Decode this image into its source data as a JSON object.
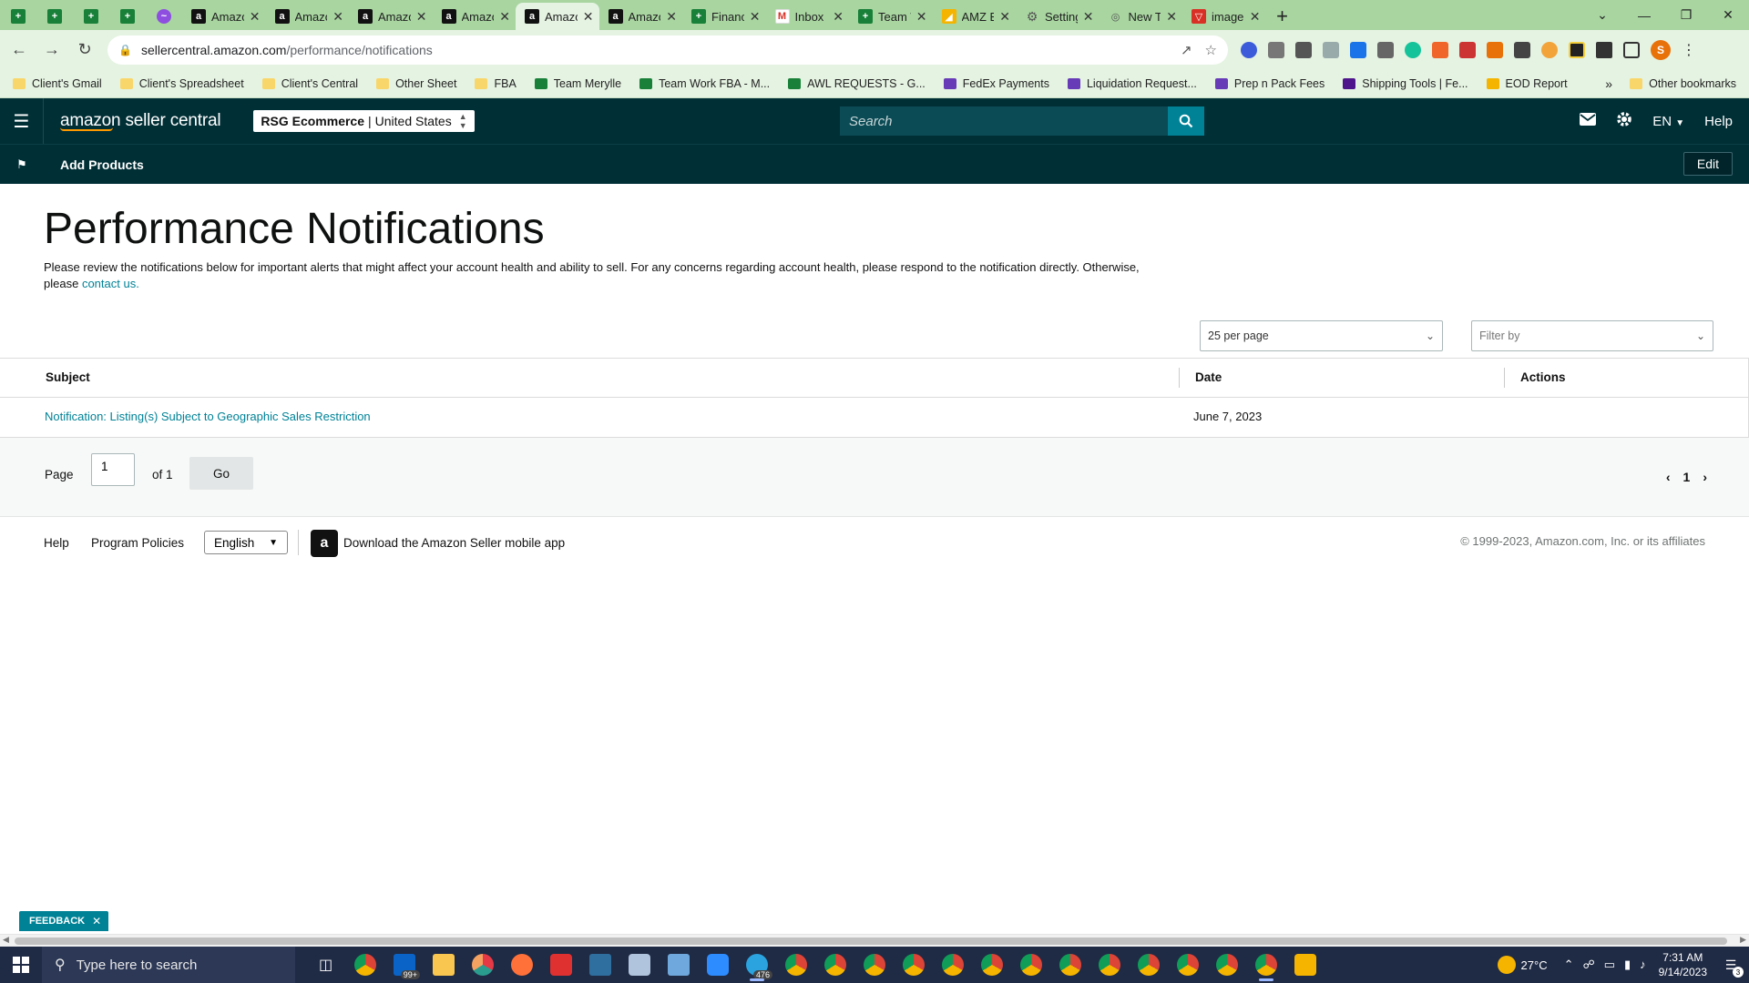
{
  "browser": {
    "tabs": [
      {
        "title": "",
        "icon": "sheets-icon",
        "pinned": true
      },
      {
        "title": "",
        "icon": "sheets-icon",
        "pinned": true
      },
      {
        "title": "",
        "icon": "sheets-icon",
        "pinned": true
      },
      {
        "title": "",
        "icon": "sheets-icon",
        "pinned": true
      },
      {
        "title": "",
        "icon": "messenger-icon",
        "pinned": true
      },
      {
        "title": "Amazon",
        "icon": "amazon-icon"
      },
      {
        "title": "Amazon",
        "icon": "amazon-icon"
      },
      {
        "title": "Amazon",
        "icon": "amazon-icon"
      },
      {
        "title": "Amazon",
        "icon": "amazon-icon"
      },
      {
        "title": "Amazon",
        "icon": "amazon-icon",
        "active": true
      },
      {
        "title": "Amazon",
        "icon": "amazon-icon"
      },
      {
        "title": "Finance",
        "icon": "sheets-icon"
      },
      {
        "title": "Inbox - r",
        "icon": "gmail-icon"
      },
      {
        "title": "Team Wo",
        "icon": "sheets-icon"
      },
      {
        "title": "AMZ EO",
        "icon": "amz-eod-icon"
      },
      {
        "title": "Settings",
        "icon": "gear-icon"
      },
      {
        "title": "New Tab",
        "icon": "globe-icon"
      },
      {
        "title": "image -",
        "icon": "image-icon"
      }
    ],
    "url_domain": "sellercentral.amazon.com",
    "url_path": "/performance/notifications",
    "bookmarks": [
      {
        "label": "Client's Gmail",
        "icon": "folder"
      },
      {
        "label": "Client's Spreadsheet",
        "icon": "folder"
      },
      {
        "label": "Client's Central",
        "icon": "folder"
      },
      {
        "label": "Other Sheet",
        "icon": "folder"
      },
      {
        "label": "FBA",
        "icon": "folder"
      },
      {
        "label": "Team Merylle",
        "icon": "sheet"
      },
      {
        "label": "Team Work FBA - M...",
        "icon": "sheet"
      },
      {
        "label": "AWL REQUESTS - G...",
        "icon": "sheet"
      },
      {
        "label": "FedEx Payments",
        "icon": "form"
      },
      {
        "label": "Liquidation Request...",
        "icon": "form"
      },
      {
        "label": "Prep n Pack Fees",
        "icon": "form"
      },
      {
        "label": "Shipping Tools | Fe...",
        "icon": "fedex"
      },
      {
        "label": "EOD Report",
        "icon": "amzeod"
      }
    ],
    "bookmarks_more": "»",
    "other_bookmarks": "Other bookmarks",
    "profile_initial": "S"
  },
  "header": {
    "logo_text": "amazon seller central",
    "account_name": "RSG Ecommerce",
    "account_sep": "|",
    "account_region": "United States",
    "search_placeholder": "Search",
    "language": "EN",
    "help": "Help"
  },
  "subnav": {
    "add_products": "Add Products",
    "edit": "Edit"
  },
  "page": {
    "title": "Performance Notifications",
    "intro": "Please review the notifications below for important alerts that might affect your account health and ability to sell. For any concerns regarding account health, please respond to the notification directly. Otherwise, please",
    "contact_link": "contact us.",
    "per_page": "25 per page",
    "filter_placeholder": "Filter by",
    "columns": {
      "subject": "Subject",
      "date": "Date",
      "actions": "Actions"
    },
    "rows": [
      {
        "subject": "Notification: Listing(s) Subject to Geographic Sales Restriction",
        "date": "June 7, 2023",
        "actions": ""
      }
    ],
    "pager": {
      "page_label": "Page",
      "page_value": "1",
      "of_label": "of 1",
      "go": "Go",
      "current": "1"
    }
  },
  "footer": {
    "help": "Help",
    "program_policies": "Program Policies",
    "language": "English",
    "app_link": "Download the Amazon Seller mobile app",
    "copyright": "© 1999-2023, Amazon.com, Inc. or its affiliates"
  },
  "feedback": "FEEDBACK",
  "taskbar": {
    "search_placeholder": "Type here to search",
    "mail_badge": "99+",
    "telegram_badge": "476",
    "temperature": "27°C",
    "time": "7:31 AM",
    "date": "9/14/2023",
    "notifications_count": "3"
  },
  "colors": {
    "header_bg": "#002f36",
    "teal_accent": "#008296",
    "chrome_frame": "#a8d5a0"
  }
}
